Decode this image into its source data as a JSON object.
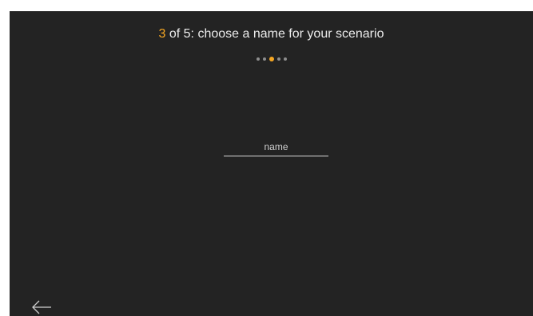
{
  "wizard": {
    "step_current": "3",
    "step_title": " of 5: choose a name for your scenario",
    "total_steps": 5,
    "active_step_index": 3
  },
  "name_input": {
    "placeholder": "name",
    "value": ""
  },
  "icons": {
    "back": "arrow-left-icon"
  },
  "colors": {
    "background": "#232323",
    "accent": "#f5a623",
    "text": "#ececec",
    "dot_inactive": "#8f8f8f"
  }
}
